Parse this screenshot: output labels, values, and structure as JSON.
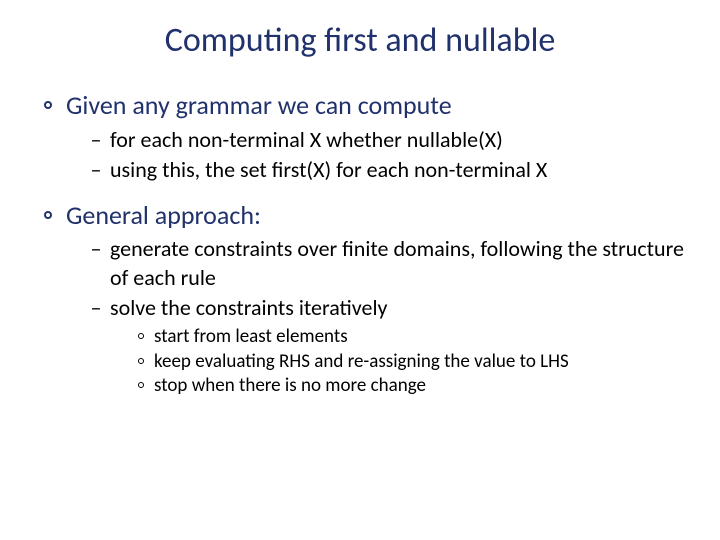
{
  "title": "Computing first and nullable",
  "items": [
    {
      "level": 1,
      "text": "Given any grammar we can compute",
      "children": [
        {
          "level": 2,
          "text": "for each non-terminal X whether nullable(X)"
        },
        {
          "level": 2,
          "text": "using this, the set first(X) for each non-terminal X"
        }
      ]
    },
    {
      "level": 1,
      "text": "General approach:",
      "children": [
        {
          "level": 2,
          "text": "generate constraints over finite domains, following the structure of each rule"
        },
        {
          "level": 2,
          "text": "solve the constraints iteratively",
          "children": [
            {
              "level": 3,
              "text": "start from least elements"
            },
            {
              "level": 3,
              "text": "keep evaluating RHS and re-assigning the value to LHS"
            },
            {
              "level": 3,
              "text": "stop when there is no more change"
            }
          ]
        }
      ]
    }
  ]
}
